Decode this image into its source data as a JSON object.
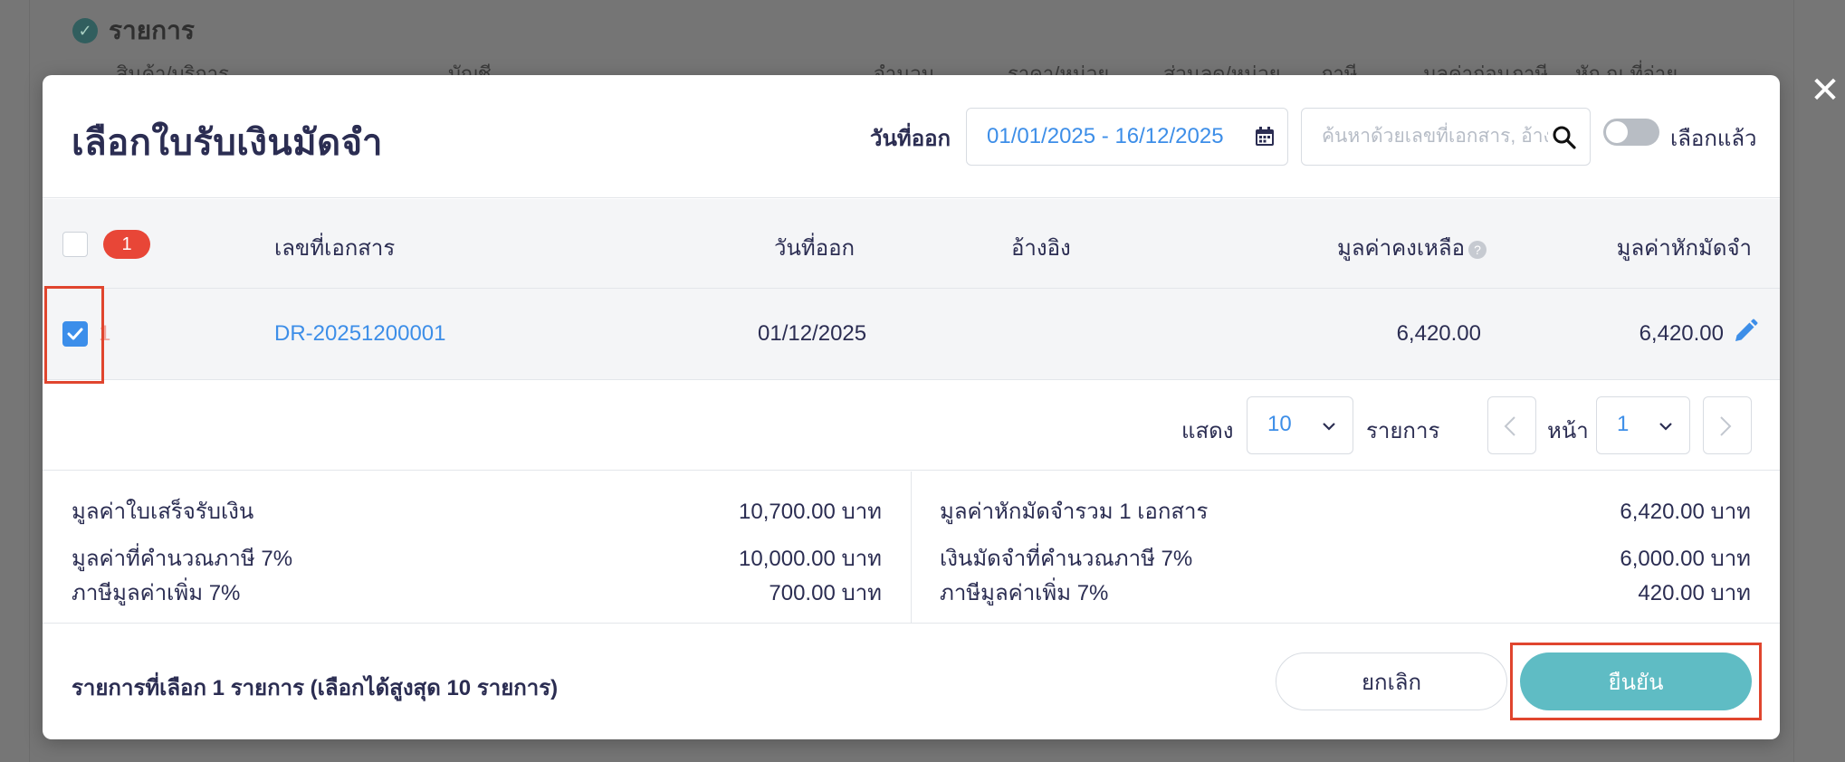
{
  "background": {
    "section_title": "รายการ",
    "columns": [
      "สินค้า/บริการ",
      "บัญชี",
      "จำนวน",
      "ราคา/หน่วย",
      "ส่วนลด/หน่วย",
      "ภาษี",
      "มูลค่าก่อนภาษี",
      "หัก ณ ที่จ่าย"
    ]
  },
  "modal": {
    "title": "เลือกใบรับเงินมัดจำ",
    "date_label": "วันที่ออก",
    "date_range": "01/01/2025 - 16/12/2025",
    "search_placeholder": "ค้นหาด้วยเลขที่เอกสาร, อ้างอิง",
    "toggle_label": "เลือกแล้ว",
    "toggle_on": false
  },
  "table": {
    "selected_count_badge": "1",
    "headers": {
      "doc_no": "เลขที่เอกสาร",
      "issue_date": "วันที่ออก",
      "reference": "อ้างอิง",
      "remaining": "มูลค่าคงเหลือ",
      "deduct": "มูลค่าหักมัดจำ"
    },
    "rows": [
      {
        "index": "1",
        "doc_no": "DR-20251200001",
        "issue_date": "01/12/2025",
        "reference": "",
        "remaining": "6,420.00",
        "deduct": "6,420.00",
        "checked": true
      }
    ]
  },
  "pagination": {
    "show_label": "แสดง",
    "per_page": "10",
    "items_label": "รายการ",
    "page_label": "หน้า",
    "page": "1"
  },
  "summary": {
    "left": [
      {
        "label": "มูลค่าใบเสร็จรับเงิน",
        "value": "10,700.00 บาท"
      },
      {
        "label": "มูลค่าที่คำนวณภาษี 7%",
        "value": "10,000.00 บาท"
      },
      {
        "label": "ภาษีมูลค่าเพิ่ม 7%",
        "value": "700.00 บาท"
      }
    ],
    "right": [
      {
        "label": "มูลค่าหักมัดจำรวม 1 เอกสาร",
        "value": "6,420.00 บาท"
      },
      {
        "label": "เงินมัดจำที่คำนวณภาษี 7%",
        "value": "6,000.00 บาท"
      },
      {
        "label": "ภาษีมูลค่าเพิ่ม 7%",
        "value": "420.00 บาท"
      }
    ]
  },
  "footer": {
    "selection_text": "รายการที่เลือก 1 รายการ (เลือกได้สูงสุด 10 รายการ)",
    "cancel_label": "ยกเลิก",
    "confirm_label": "ยืนยัน"
  },
  "colors": {
    "accent_blue": "#3d8ee8",
    "confirm_teal": "#5fbcc4",
    "badge_red": "#e84637",
    "highlight_red": "#e0452e",
    "title_navy": "#2b2d52"
  }
}
